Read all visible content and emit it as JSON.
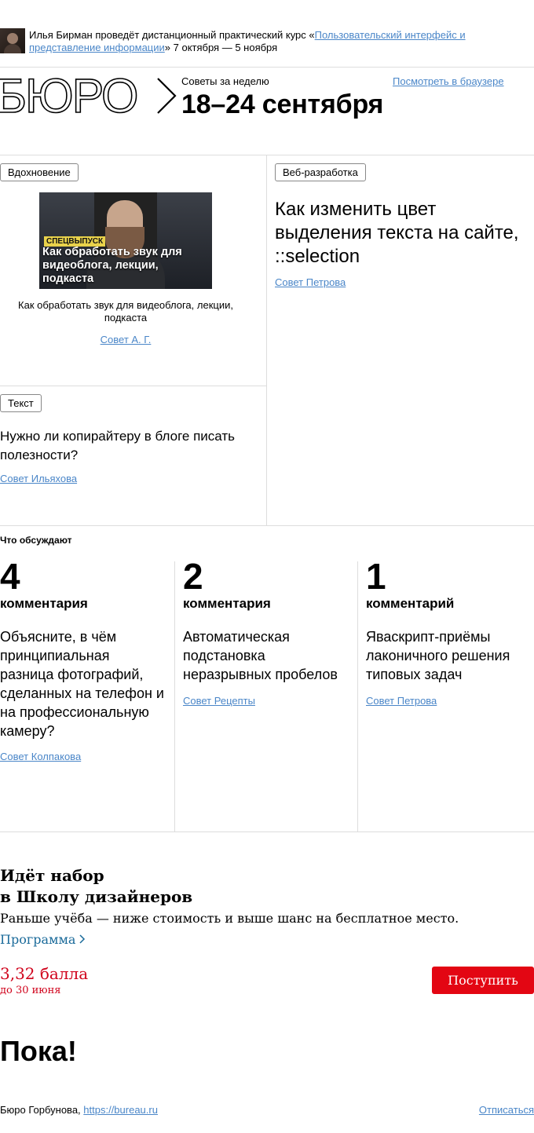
{
  "announcement": {
    "prefix": "Илья Бирман проведёт дистанционный практический курс «",
    "course_link": "Пользовательский интерфейс и представление информации",
    "suffix": "» 7 октября — 5 ноября"
  },
  "header": {
    "logo_text": "БЮРО",
    "digest_label": "Советы за неделю",
    "digest_dates": "18–24 сентября",
    "browser_link": "Посмотреть в браузере"
  },
  "cells": [
    {
      "tag": "Вдохновение",
      "image": {
        "badge": "СПЕЦВЫПУСК",
        "title": "Как обработать звук для видеоблога, лекции, подкаста"
      },
      "caption": "Как обработать звук для видеоблога, лекции, подкаста",
      "author": "Совет А. Г."
    },
    {
      "tag": "Веб-разработка",
      "title": "Как изменить цвет выделения текста на сайте, ::selection",
      "author": "Совет Петрова"
    },
    {
      "tag": "Текст",
      "title": "Нужно ли копирайтеру в блоге писать полезности?",
      "author": "Совет Ильяхова"
    }
  ],
  "discussed": {
    "title": "Что обсуждают",
    "items": [
      {
        "count": "4",
        "count_label": "комментария",
        "topic": "Объясните, в чём принципиальная разница фотографий, сделанных на телефон и на профессиональную камеру?",
        "author": "Совет Колпакова"
      },
      {
        "count": "2",
        "count_label": "комментария",
        "topic": "Автоматическая подстановка неразрывных пробелов",
        "author": "Совет Рецепты"
      },
      {
        "count": "1",
        "count_label": "комментарий",
        "topic": "Яваскрипт-приёмы лаконичного решения типовых задач",
        "author": "Совет Петрова"
      }
    ]
  },
  "school": {
    "title_line1": "Идёт набор",
    "title_line2": "в Школу дизайнеров",
    "subtitle": "Раньше учёба — ниже стоимость и выше шанс на бесплатное место.",
    "program_link": "Программа",
    "score": "3,32 балла",
    "deadline": "до 30 июня",
    "apply_button": "Поступить"
  },
  "farewell": "Пока!",
  "footer": {
    "company": "Бюро Горбунова,",
    "site_link": "https://bureau.ru",
    "unsubscribe": "Отписаться"
  },
  "colors": {
    "link": "#4a86c8",
    "accent_red": "#e30613",
    "program_link": "#1a6a9a"
  }
}
